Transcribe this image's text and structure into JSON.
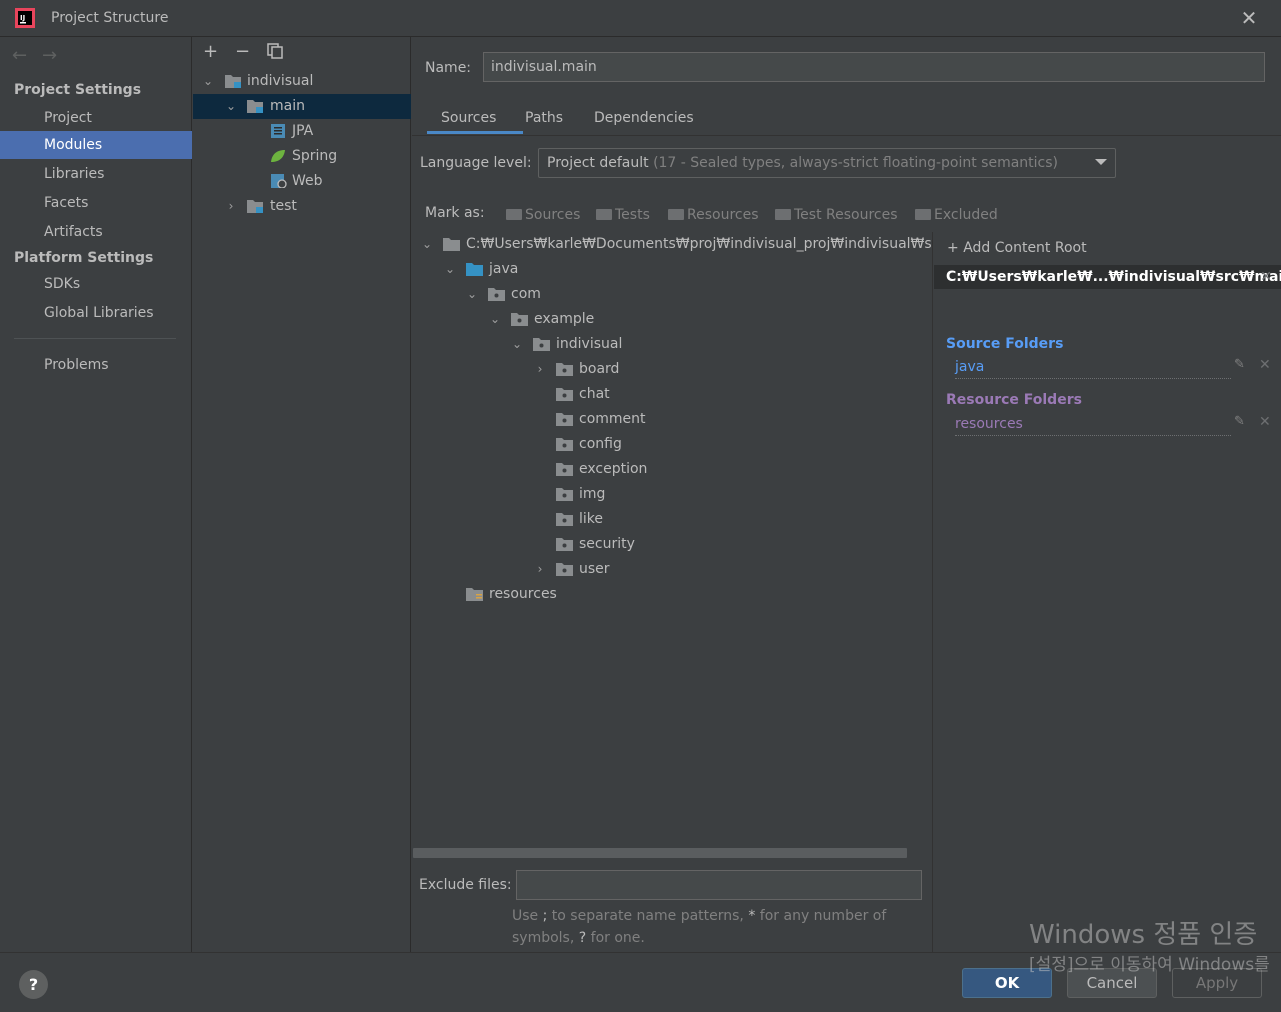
{
  "window": {
    "title": "Project Structure"
  },
  "left_nav": {
    "project_settings_header": "Project Settings",
    "project_settings_items": [
      "Project",
      "Modules",
      "Libraries",
      "Facets",
      "Artifacts"
    ],
    "selected": "Modules",
    "platform_settings_header": "Platform Settings",
    "platform_settings_items": [
      "SDKs",
      "Global Libraries"
    ],
    "problems": "Problems"
  },
  "module_tree": {
    "root": "indivisual",
    "main": "main",
    "facets": [
      "JPA",
      "Spring",
      "Web"
    ],
    "test": "test"
  },
  "details": {
    "name_label": "Name:",
    "name_value": "indivisual.main",
    "tabs": [
      "Sources",
      "Paths",
      "Dependencies"
    ],
    "active_tab": "Sources",
    "language_level_label": "Language level:",
    "language_level_value": "Project default",
    "language_level_detail": "(17 - Sealed types, always-strict floating-point semantics)",
    "mark_as_label": "Mark as:",
    "mark_as_options": [
      "Sources",
      "Tests",
      "Resources",
      "Test Resources",
      "Excluded"
    ],
    "tree": {
      "root_path": "C:₩Users₩karle₩Documents₩proj₩indivisual_proj₩indivisual₩src₩main",
      "java": "java",
      "com": "com",
      "example": "example",
      "indivisual": "indivisual",
      "packages": [
        "board",
        "chat",
        "comment",
        "config",
        "exception",
        "img",
        "like",
        "security",
        "user"
      ],
      "resources": "resources"
    },
    "exclude_files_label": "Exclude files:",
    "exclude_files_value": "",
    "exclude_hint_1": "Use ",
    "exclude_hint_semicolon": ";",
    "exclude_hint_2": " to separate name patterns, ",
    "exclude_hint_star": "*",
    "exclude_hint_3": " for any number of symbols, ",
    "exclude_hint_q": "?",
    "exclude_hint_4": " for one."
  },
  "content_root": {
    "add_label": "Add Content Root",
    "path": "C:₩Users₩karle₩...₩indivisual₩src₩main",
    "source_folders_header": "Source Folders",
    "source_folder": "java",
    "resource_folders_header": "Resource Folders",
    "resource_folder": "resources",
    "source_color": "#589df6",
    "resource_color": "#9b7ab6"
  },
  "buttons": {
    "help": "?",
    "ok": "OK",
    "cancel": "Cancel",
    "apply": "Apply"
  },
  "watermark": {
    "line1": "Windows 정품 인증",
    "line2": "[설정]으로 이동하여 Windows를"
  }
}
